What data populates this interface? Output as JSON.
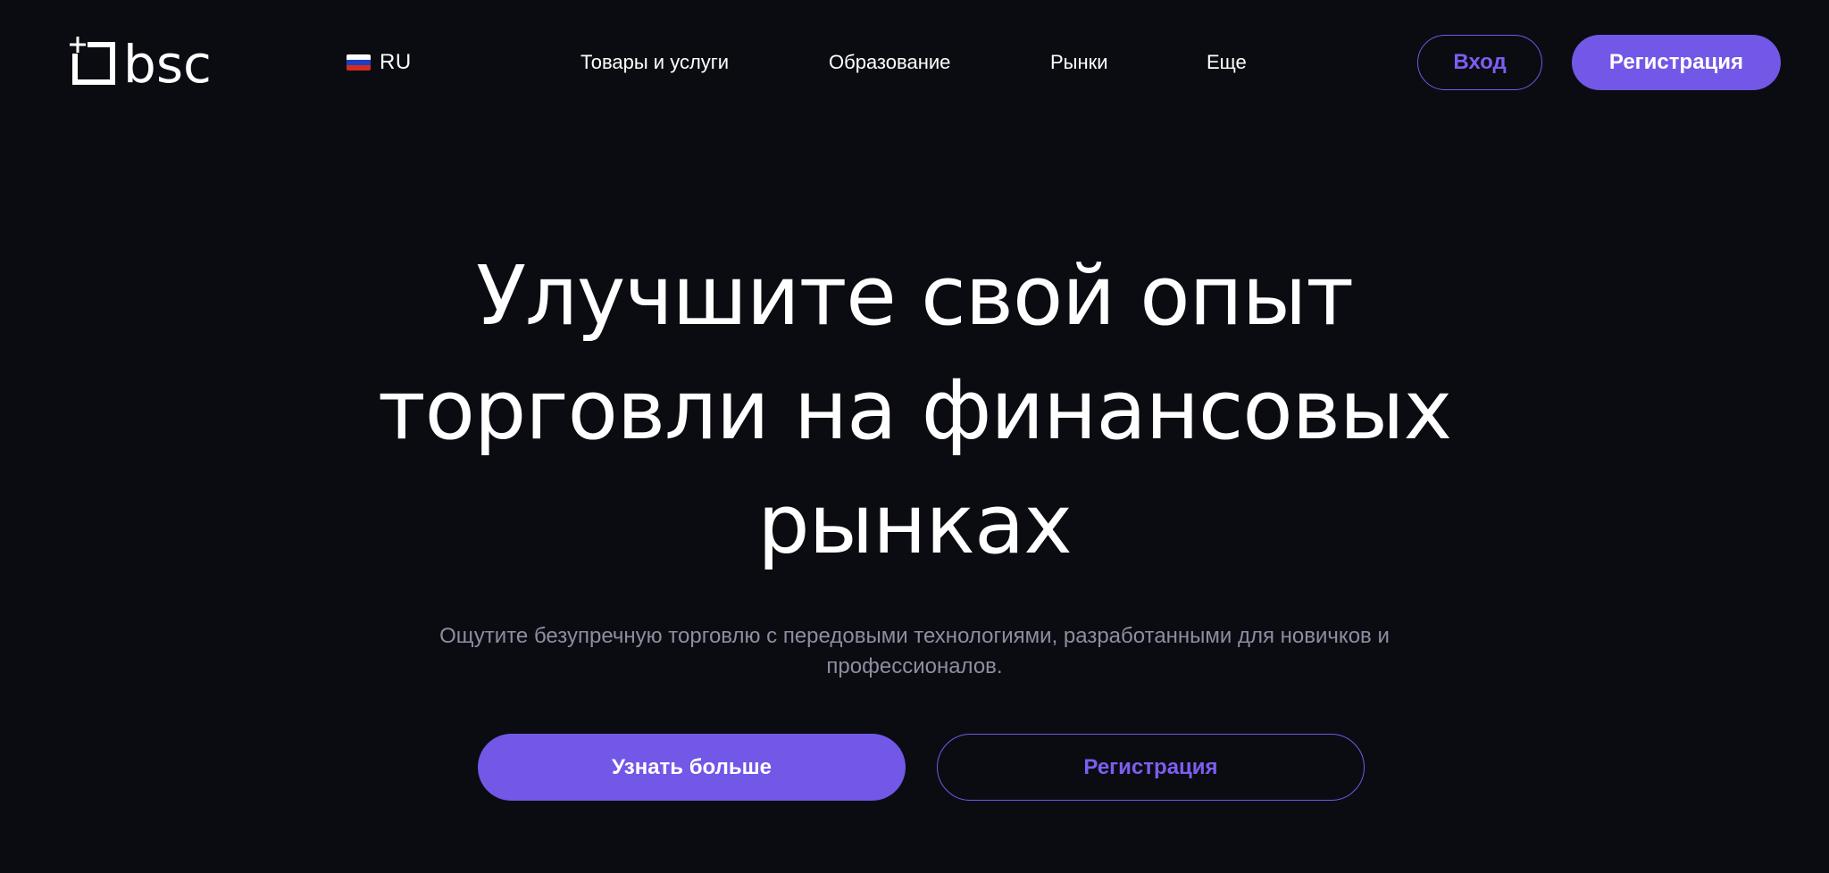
{
  "brand": {
    "logo_text": "bsc",
    "accent_color": "#7357e7",
    "background_color": "#0b0c12"
  },
  "header": {
    "language": {
      "label": "RU",
      "flag_icon": "russia-flag-icon",
      "flag_colors": [
        "#ffffff",
        "#1c3fc4",
        "#d52b1e"
      ]
    },
    "nav": [
      {
        "label": "Товары и услуги"
      },
      {
        "label": "Образование"
      },
      {
        "label": "Рынки"
      },
      {
        "label": "Еще"
      }
    ],
    "login_label": "Вход",
    "register_label": "Регистрация"
  },
  "hero": {
    "title_lines": [
      "Улучшите свой опыт",
      "торговли на финансовых",
      "рынках"
    ],
    "subtitle_lines": [
      "Ощутите безупречную торговлю с передовыми технологиями, разработанными для новичков и",
      "профессионалов."
    ],
    "primary_cta": "Узнать больше",
    "secondary_cta": "Регистрация"
  }
}
